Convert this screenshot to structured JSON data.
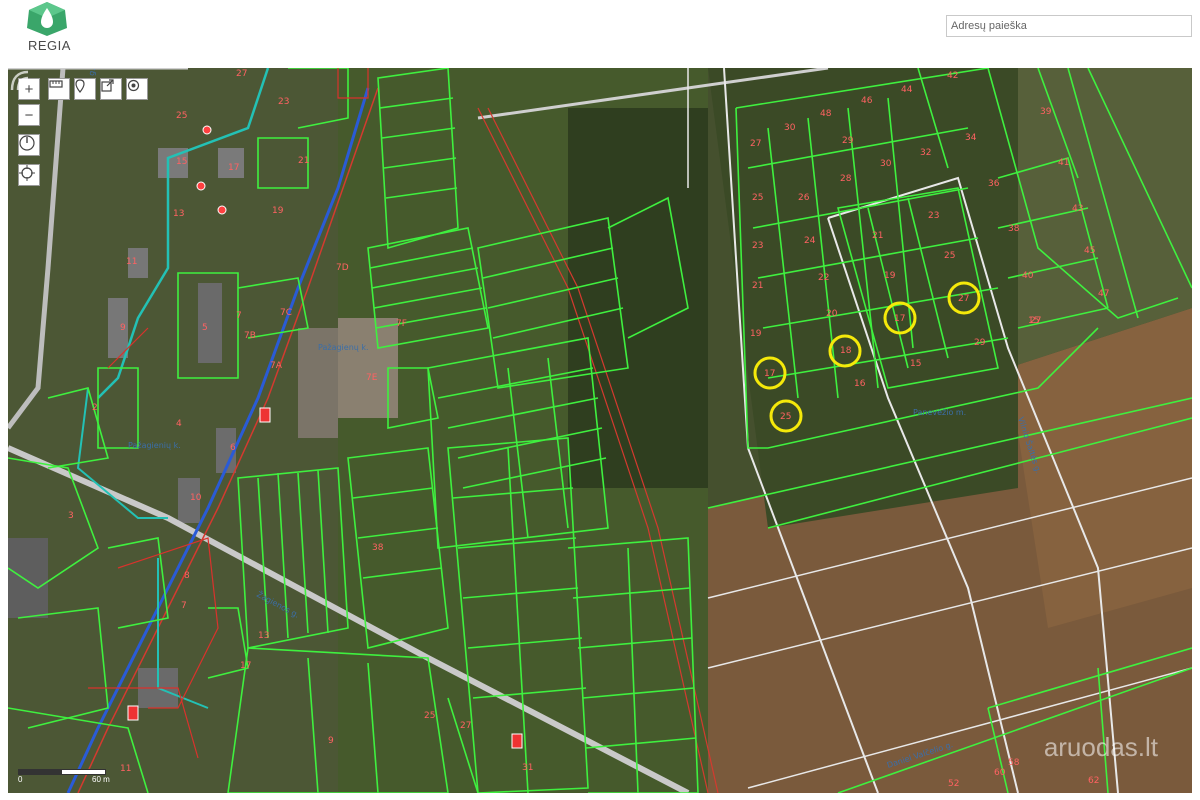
{
  "header": {
    "logo_text": "REGIA",
    "search_placeholder": "Adresų paieška"
  },
  "toolbar": {
    "zoom_in": "+",
    "zoom_out": "−"
  },
  "map": {
    "street_labels": [
      "Syvų g.",
      "Pažagienų k.",
      "Pažagienių k.",
      "Žagienos g.",
      "Panevėžio m.",
      "Vilnio Šaltės g.",
      "Daniel Valčelio g."
    ],
    "parcel_numbers": [
      "42",
      "46",
      "44",
      "39",
      "48",
      "30",
      "29",
      "32",
      "34",
      "27",
      "28",
      "30",
      "36",
      "41",
      "25",
      "26",
      "23",
      "43",
      "23",
      "24",
      "21",
      "38",
      "22",
      "19",
      "25",
      "45",
      "21",
      "40",
      "47",
      "20",
      "27",
      "27",
      "19",
      "18",
      "17",
      "42",
      "29",
      "17",
      "16",
      "15",
      "15",
      "25",
      "7B",
      "7A",
      "7C",
      "7D",
      "7E",
      "7",
      "7F",
      "5",
      "3",
      "4",
      "6",
      "10",
      "2",
      "13",
      "11",
      "9",
      "8",
      "7",
      "15",
      "17",
      "19",
      "21",
      "23",
      "25",
      "27",
      "9",
      "11",
      "13",
      "38",
      "17",
      "25",
      "27",
      "31",
      "60",
      "58",
      "52",
      "62"
    ],
    "watermark": "aruodas.lt",
    "scale_left": "0",
    "scale_right": "60 m"
  },
  "circles": [
    {
      "label": "27"
    },
    {
      "label": "17"
    },
    {
      "label": "18"
    },
    {
      "label": "17"
    },
    {
      "label": "15"
    }
  ]
}
